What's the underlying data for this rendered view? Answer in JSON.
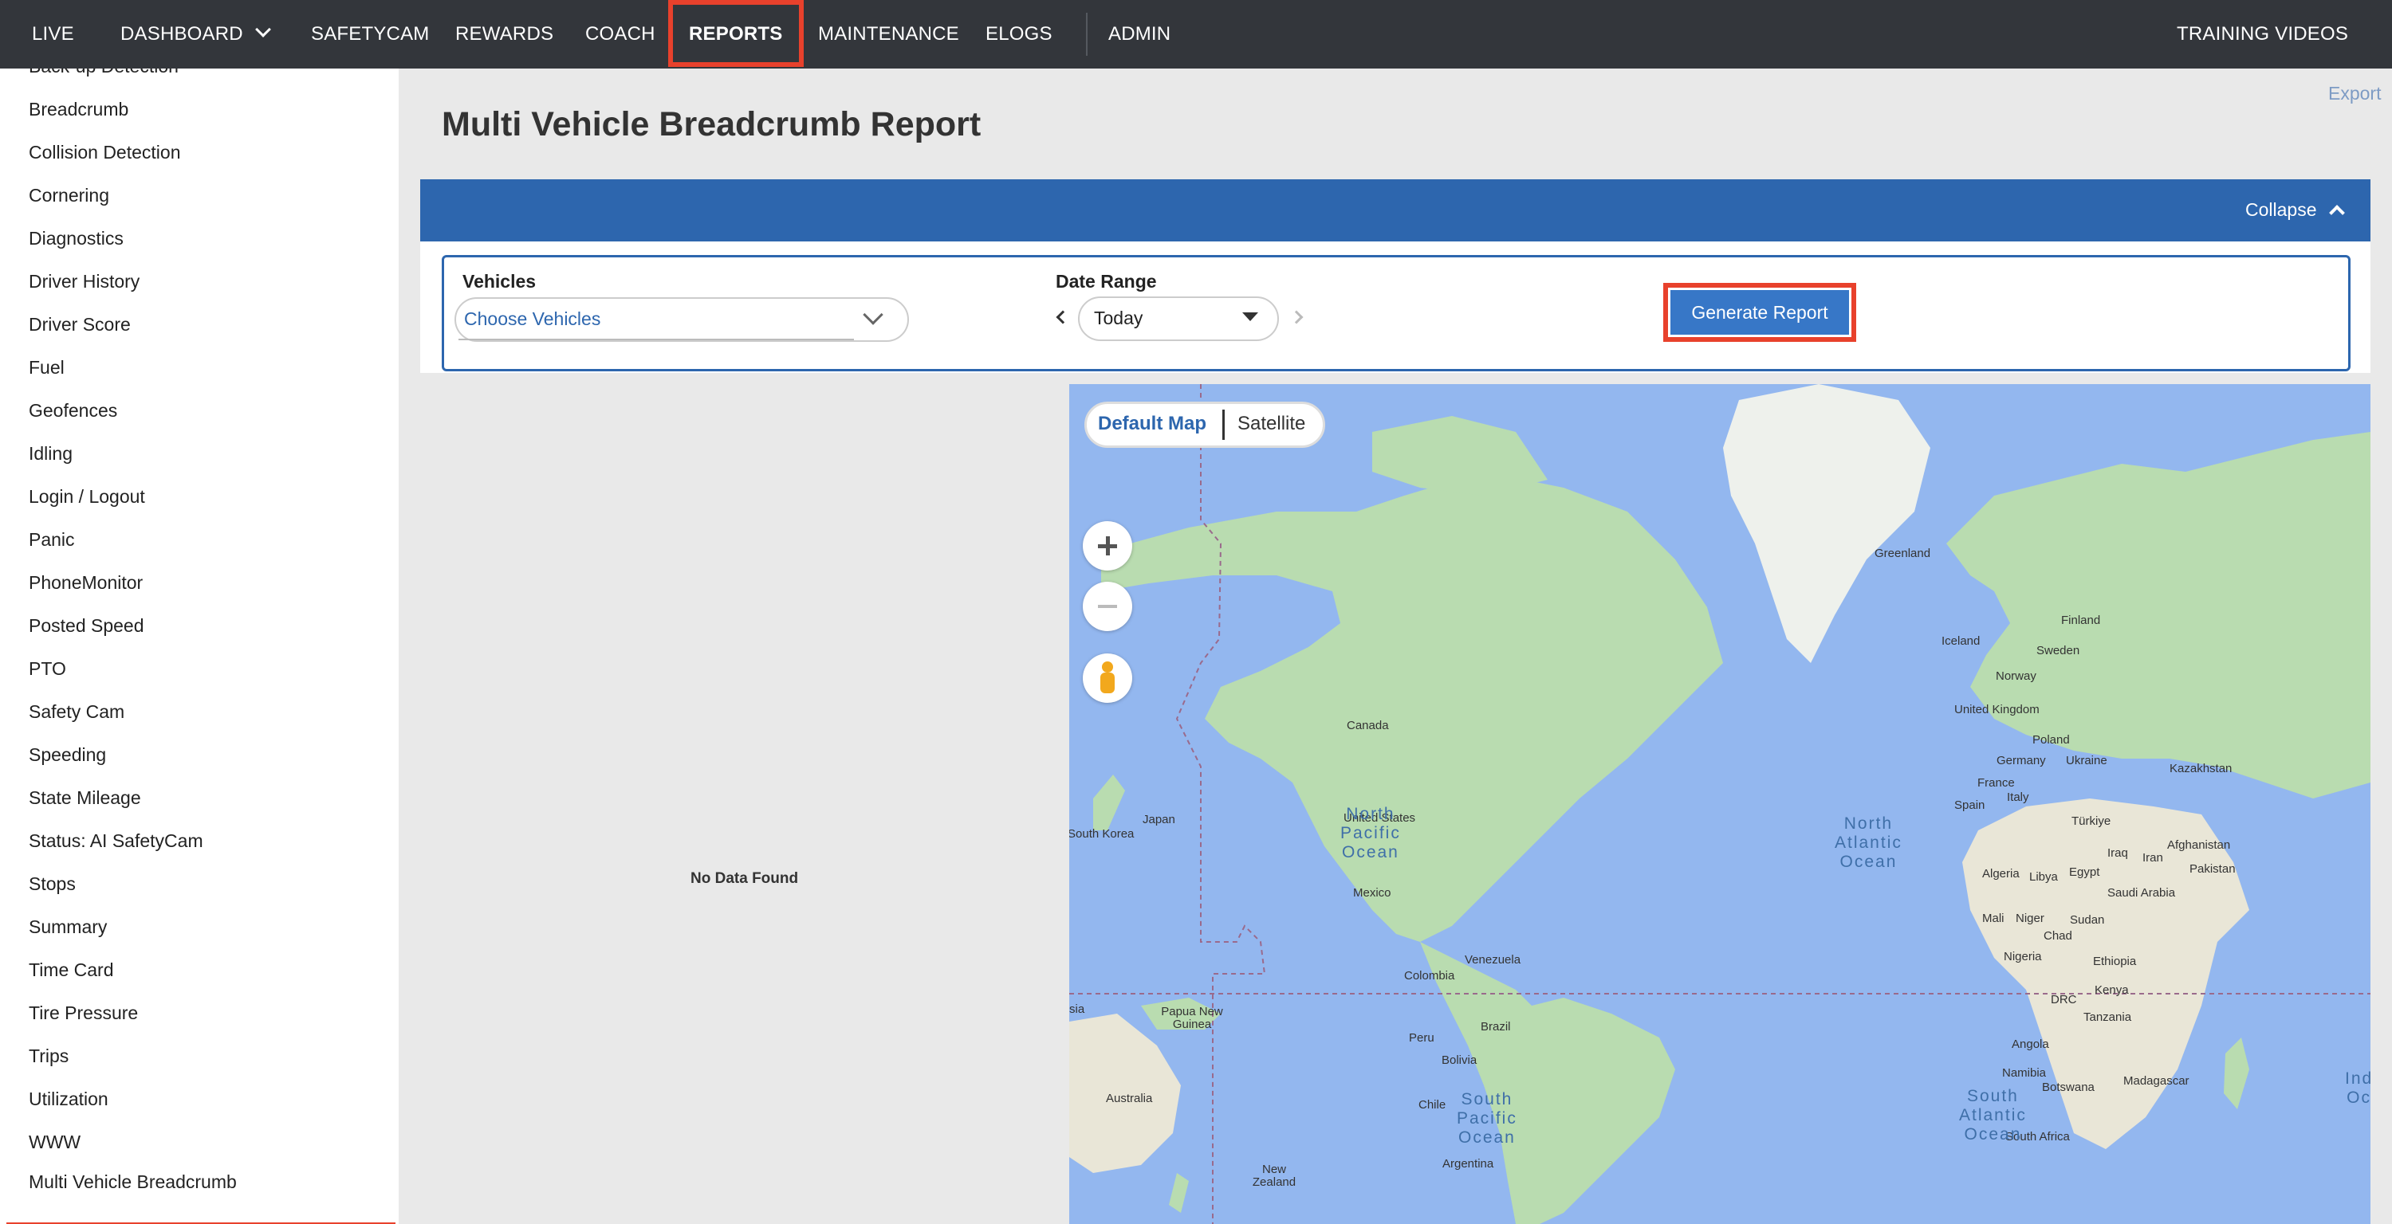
{
  "nav": {
    "live": "LIVE",
    "dashboard": "DASHBOARD",
    "safetycam": "SAFETYCAM",
    "rewards": "REWARDS",
    "coach": "COACH",
    "reports": "REPORTS",
    "maintenance": "MAINTENANCE",
    "elogs": "ELOGS",
    "admin": "ADMIN",
    "training_videos": "TRAINING VIDEOS"
  },
  "sidebar": {
    "items": [
      "Back-up Detection",
      "Breadcrumb",
      "Collision Detection",
      "Cornering",
      "Diagnostics",
      "Driver History",
      "Driver Score",
      "Fuel",
      "Geofences",
      "Idling",
      "Login / Logout",
      "Panic",
      "PhoneMonitor",
      "Posted Speed",
      "PTO",
      "Safety Cam",
      "Speeding",
      "State Mileage",
      "Status: AI SafetyCam",
      "Stops",
      "Summary",
      "Time Card",
      "Tire Pressure",
      "Trips",
      "Utilization",
      "WWW",
      "Multi Vehicle Breadcrumb"
    ],
    "selected": "Multi Vehicle Breadcrumb"
  },
  "page": {
    "title": "Multi Vehicle Breadcrumb Report",
    "export": "Export",
    "collapse": "Collapse",
    "no_data": "No Data Found"
  },
  "form": {
    "vehicles_label": "Vehicles",
    "vehicles_placeholder": "Choose Vehicles",
    "date_label": "Date Range",
    "date_value": "Today",
    "generate": "Generate Report"
  },
  "map": {
    "default_map": "Default Map",
    "satellite": "Satellite",
    "labels": {
      "greenland": "Greenland",
      "iceland": "Iceland",
      "finland": "Finland",
      "sweden": "Sweden",
      "norway": "Norway",
      "uk": "United Kingdom",
      "poland": "Poland",
      "germany": "Germany",
      "ukraine": "Ukraine",
      "kazakhstan": "Kazakhstan",
      "france": "France",
      "spain": "Spain",
      "italy": "Italy",
      "turkiye": "Türkiye",
      "afghanistan": "Afghanistan",
      "iraq": "Iraq",
      "iran": "Iran",
      "pakistan": "Pakistan",
      "algeria": "Algeria",
      "libya": "Libya",
      "egypt": "Egypt",
      "saudi": "Saudi Arabia",
      "mali": "Mali",
      "niger": "Niger",
      "sudan": "Sudan",
      "chad": "Chad",
      "nigeria": "Nigeria",
      "ethiopia": "Ethiopia",
      "kenya": "Kenya",
      "drc": "DRC",
      "tanzania": "Tanzania",
      "angola": "Angola",
      "namibia": "Namibia",
      "botswana": "Botswana",
      "madagascar": "Madagascar",
      "south_africa": "South Africa",
      "canada": "Canada",
      "us": "United States",
      "mexico": "Mexico",
      "venezuela": "Venezuela",
      "colombia": "Colombia",
      "brazil": "Brazil",
      "peru": "Peru",
      "bolivia": "Bolivia",
      "chile": "Chile",
      "argentina": "Argentina",
      "japan": "Japan",
      "south_korea": "South Korea",
      "png": "Papua New Guinea",
      "australia": "Australia",
      "new_zealand": "New Zealand",
      "asia": "sia"
    },
    "oceans": {
      "north_pacific": "North\nPacific\nOcean",
      "north_atlantic": "North\nAtlantic\nOcean",
      "south_pacific": "South\nPacific\nOcean",
      "south_atlantic": "South\nAtlantic\nOcean",
      "indian": "Ind\nOc"
    }
  },
  "colors": {
    "nav_bg": "#33363b",
    "accent": "#2d66ae",
    "button": "#3777c7",
    "highlight": "#e8412c",
    "ocean": "#93b7ef",
    "land": "#b9dcb0"
  }
}
